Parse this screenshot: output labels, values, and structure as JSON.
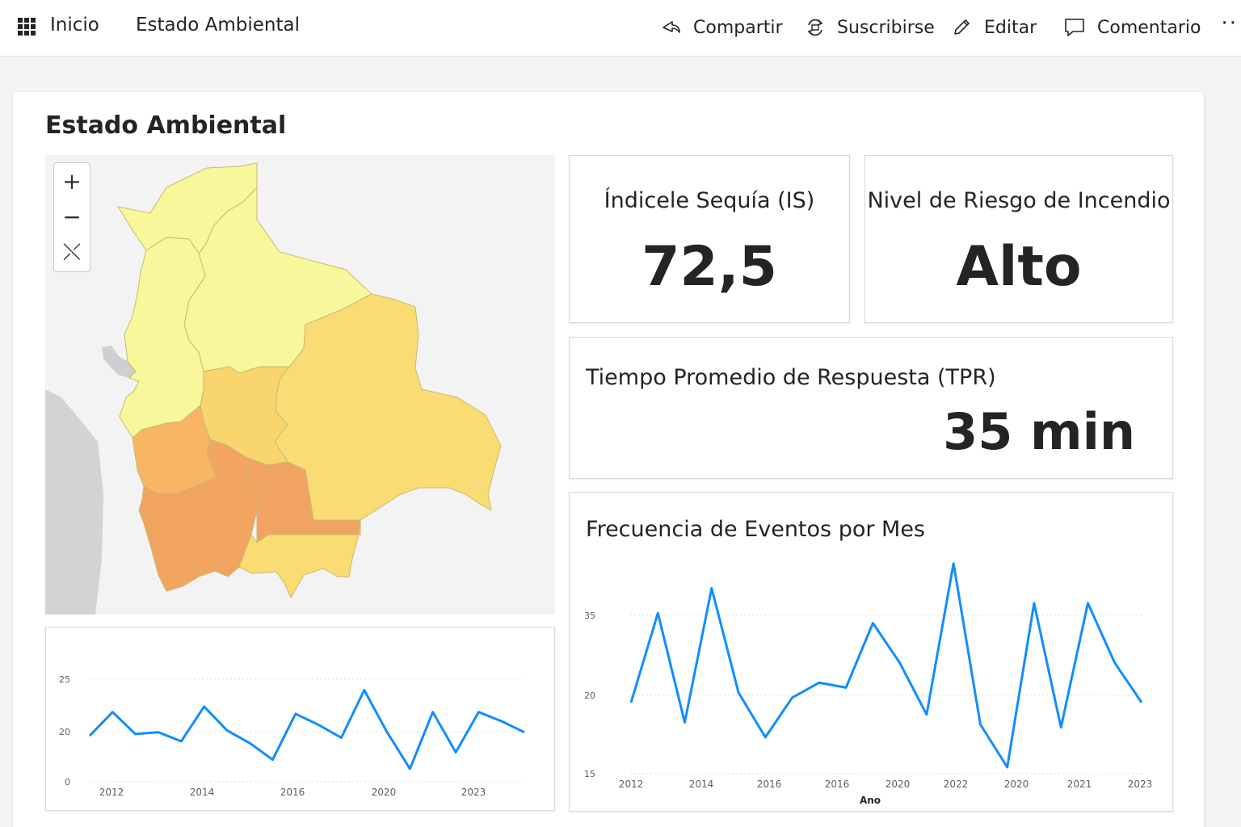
{
  "topbar": {
    "home": "Inicio",
    "report": "Estado Ambiental",
    "actions": {
      "share": "Compartir",
      "subscribe": "Suscribirse",
      "edit": "Editar",
      "comment": "Comentario"
    },
    "more": "··"
  },
  "page": {
    "title": "Estado Ambiental"
  },
  "map": {
    "zoom_in": "+",
    "zoom_out": "−",
    "reset": "⤬",
    "region_colors": {
      "pando": "#f8f79c",
      "beni": "#f8f79c",
      "la_paz": "#f8f79c",
      "santa_cruz": "#f9dd74",
      "cochabamba": "#f9d56e",
      "oruro": "#f8b664",
      "potosi": "#f2a461",
      "chuquisaca": "#f1a462",
      "tarija": "#f9dc72"
    }
  },
  "kpis": {
    "sequia": {
      "title": "Índicele Sequía (IS)",
      "value": "72,5"
    },
    "riesgo": {
      "title": "Nivel de Riesgo de Incendio",
      "value": "Alto"
    },
    "tpr": {
      "title": "Tiempo Promedio de Respuesta (TPR)",
      "value": "35 min"
    }
  },
  "chart_data": [
    {
      "type": "line",
      "title": "",
      "ylim": [
        0,
        30
      ],
      "y_ticks": [
        "25",
        "20",
        "0"
      ],
      "x_ticks": [
        "2012",
        "2014",
        "2016",
        "2020",
        "2023"
      ],
      "grid": true,
      "color": "#118dff",
      "values": [
        11,
        17.5,
        11.5,
        12,
        9.5,
        19,
        12.5,
        9,
        4.5,
        17,
        14,
        10.5,
        23.5,
        12,
        2,
        17.5,
        6.5,
        17.5,
        15,
        12
      ]
    },
    {
      "type": "line",
      "title": "Frecuencia de Eventos por Mes",
      "xlabel": "Ano",
      "ylabel": "",
      "ylim": [
        15,
        35
      ],
      "y_ticks": [
        "35",
        "20",
        "15"
      ],
      "x_ticks": [
        "2012",
        "2014",
        "2016",
        "2016",
        "2020",
        "2022",
        "2020",
        "2021",
        "2023"
      ],
      "grid": true,
      "color": "#118dff",
      "values": [
        22,
        31,
        20,
        33.5,
        23,
        18.5,
        22.5,
        24,
        23.5,
        30,
        26,
        20.8,
        36,
        19.8,
        15.5,
        32,
        19.5,
        32,
        26,
        22
      ]
    }
  ]
}
